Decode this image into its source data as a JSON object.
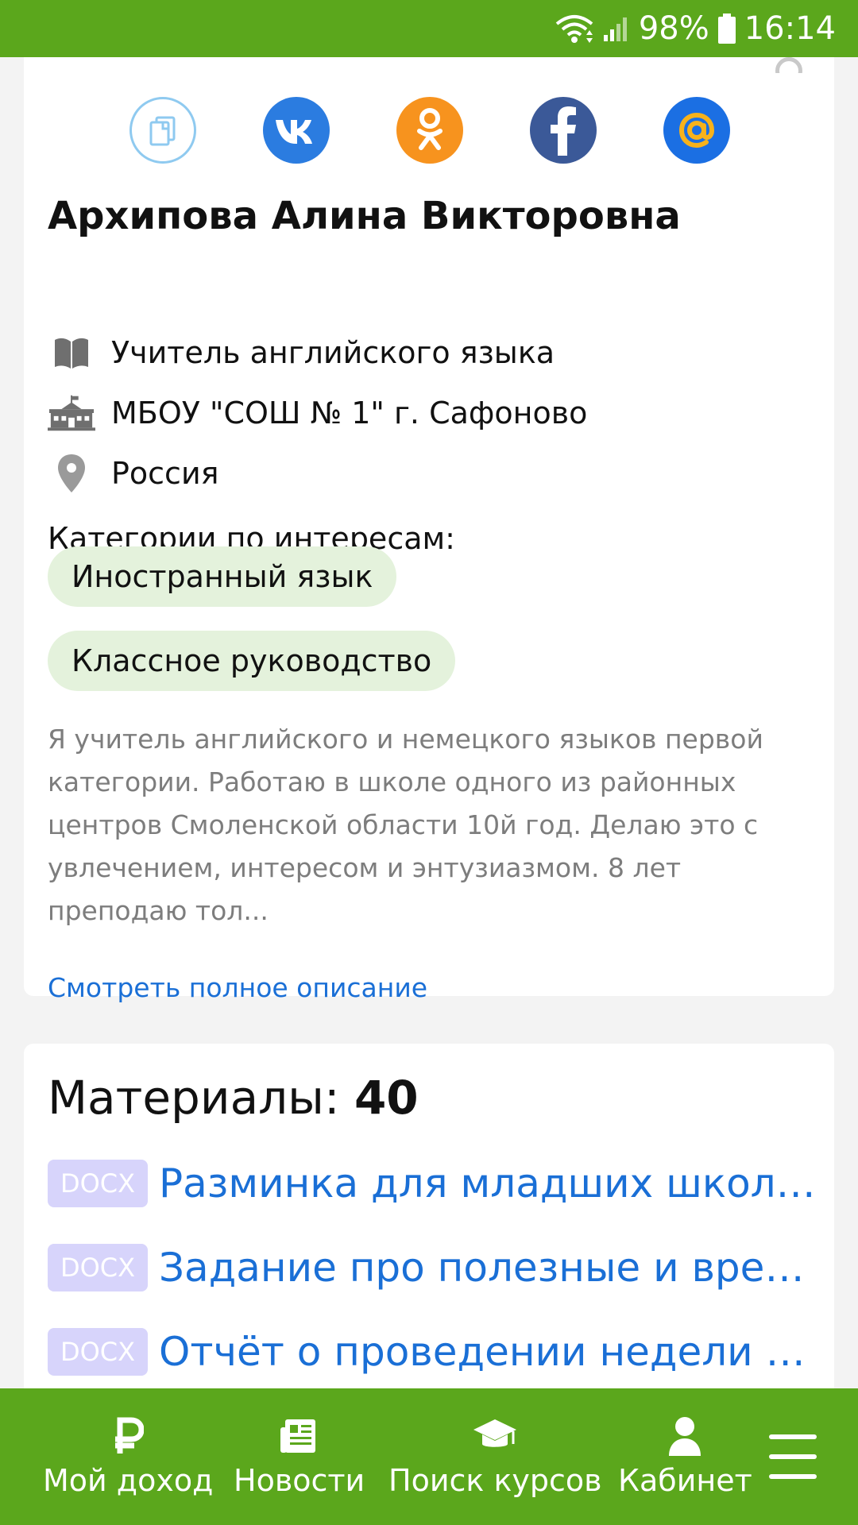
{
  "status_bar": {
    "battery": "98%",
    "time": "16:14",
    "icons": [
      "wifi-icon",
      "signal-icon",
      "battery-icon"
    ]
  },
  "profile": {
    "share_icons": [
      "copy-link-icon",
      "vk-icon",
      "odnoklassniki-icon",
      "facebook-icon",
      "mail-ru-icon"
    ],
    "name": "Архипова Алина Викторовна",
    "subject": "Учитель английского языка",
    "school": "МБОУ \"СОШ № 1\" г. Сафоново",
    "country": "Россия",
    "categories_label": "Категории по интересам:",
    "categories": [
      "Иностранный язык",
      "Классное руководство"
    ],
    "description": "Я учитель английского и немецкого языков первой категории. Работаю в школе одного из районных центров Смоленской области 10й год. Делаю это с увлечением, интересом и энтузиазмом. 8 лет преподаю тол...",
    "more_link": "Смотреть полное описание"
  },
  "materials": {
    "label": "Материалы:",
    "count": "40",
    "items": [
      {
        "type": "DOCX",
        "title": "Разминка для младших школьников"
      },
      {
        "type": "DOCX",
        "title": "Задание про полезные и вредные продукты"
      },
      {
        "type": "DOCX",
        "title": "Отчёт о проведении недели иностранного языка"
      }
    ]
  },
  "bottom_nav": {
    "items": [
      {
        "label": "Мой доход",
        "icon": "ruble-icon"
      },
      {
        "label": "Новости",
        "icon": "newspaper-icon"
      },
      {
        "label": "Поиск курсов",
        "icon": "graduation-cap-icon"
      },
      {
        "label": "Кабинет",
        "icon": "user-icon"
      }
    ],
    "menu_icon": "hamburger-menu-icon"
  },
  "colors": {
    "brand_green": "#5ba71c",
    "link_blue": "#1a6fd6",
    "tag_bg": "#e4f2dc",
    "doc_badge_bg": "#d7d4fb"
  }
}
